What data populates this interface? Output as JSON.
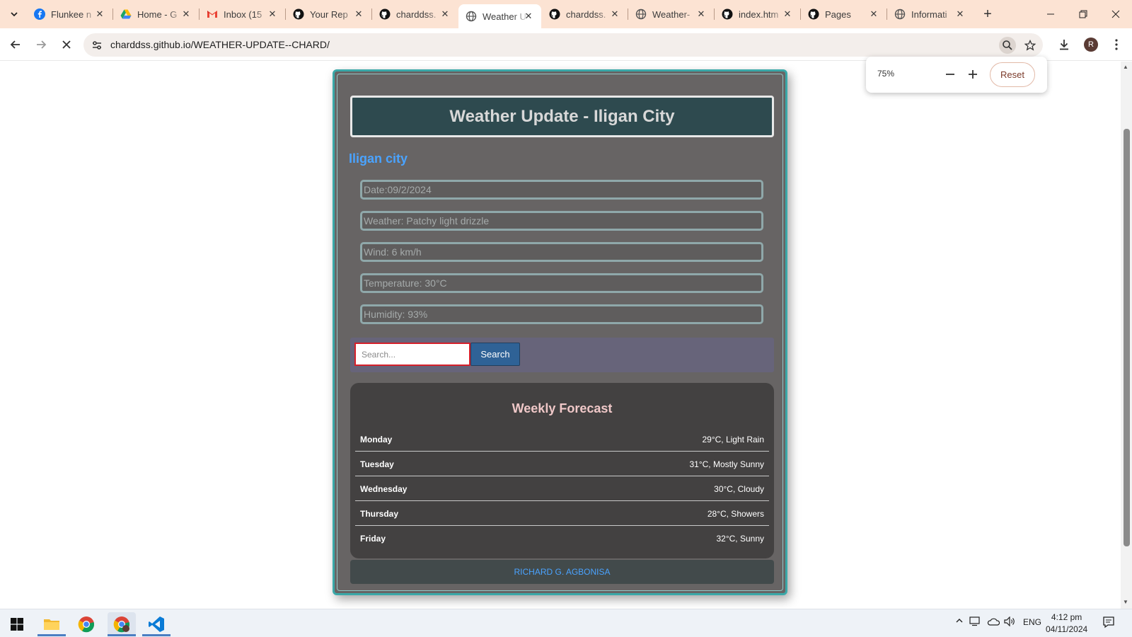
{
  "browser": {
    "tabs": [
      {
        "title": "Flunkee n",
        "icon": "facebook-icon",
        "color": "#1877f2"
      },
      {
        "title": "Home - G",
        "icon": "google-drive-icon",
        "color": "#1fa463"
      },
      {
        "title": "Inbox (15",
        "icon": "gmail-icon",
        "color": "#ea4335"
      },
      {
        "title": "Your Rep",
        "icon": "github-icon",
        "color": "#111111"
      },
      {
        "title": "charddss.",
        "icon": "github-icon",
        "color": "#111111"
      },
      {
        "title": "Weather U",
        "icon": "globe-icon",
        "color": "#555555",
        "active": true
      },
      {
        "title": "charddss.",
        "icon": "github-icon",
        "color": "#111111"
      },
      {
        "title": "Weather-",
        "icon": "globe-icon",
        "color": "#555555"
      },
      {
        "title": "index.htm",
        "icon": "github-icon",
        "color": "#111111"
      },
      {
        "title": "Pages",
        "icon": "github-icon",
        "color": "#111111"
      },
      {
        "title": "Informati",
        "icon": "globe-icon",
        "color": "#555555"
      }
    ],
    "url": "charddss.github.io/WEATHER-UPDATE--CHARD/",
    "profile_initial": "R",
    "zoom": {
      "level": "75%",
      "reset_label": "Reset"
    }
  },
  "page": {
    "header_title": "Weather Update - Iligan City",
    "city": "Iligan city",
    "info": {
      "date": "Date:09/2/2024",
      "weather": "Weather: Patchy light drizzle",
      "wind": "Wind: 6 km/h",
      "temperature": "Temperature: 30°C",
      "humidity": "Humidity: 93%"
    },
    "search": {
      "placeholder": "Search...",
      "button_label": "Search"
    },
    "forecast": {
      "title": "Weekly Forecast",
      "days": [
        {
          "day": "Monday",
          "value": "29°C, Light Rain"
        },
        {
          "day": "Tuesday",
          "value": "31°C, Mostly Sunny"
        },
        {
          "day": "Wednesday",
          "value": "30°C, Cloudy"
        },
        {
          "day": "Thursday",
          "value": "28°C, Showers"
        },
        {
          "day": "Friday",
          "value": "32°C, Sunny"
        }
      ]
    },
    "footer": "RICHARD G. AGBONISA"
  },
  "taskbar": {
    "language": "ENG",
    "time": "4:12 pm",
    "date": "04/11/2024"
  },
  "colors": {
    "card_bg": "#676464",
    "card_border": "#3aa8a8",
    "header_bg": "#2e4a4f",
    "accent_blue": "#4aa3ff",
    "search_button": "#2f6296",
    "forecast_bg": "#434141",
    "tabstrip_bg": "#fce3d3"
  }
}
